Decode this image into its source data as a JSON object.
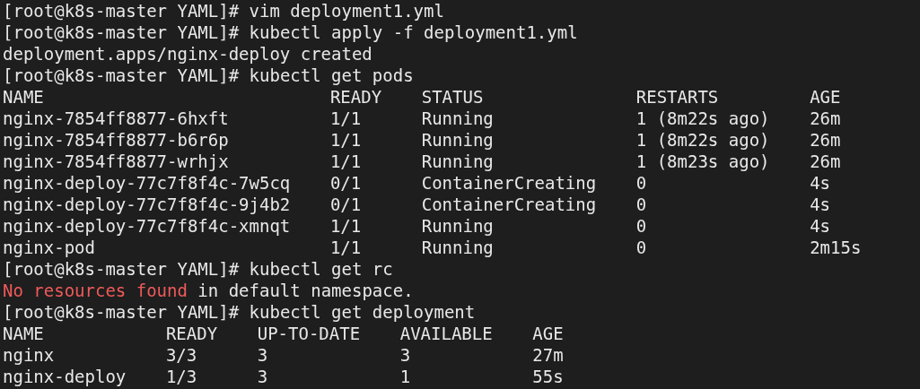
{
  "terminal": {
    "lines": [
      {
        "kind": "prompt",
        "prompt": "[root@k8s-master YAML]#",
        "command": "vim deployment1.yml"
      },
      {
        "kind": "prompt",
        "prompt": "[root@k8s-master YAML]#",
        "command": "kubectl apply -f deployment1.yml"
      },
      {
        "kind": "output",
        "text": "deployment.apps/nginx-deploy created"
      },
      {
        "kind": "prompt",
        "prompt": "[root@k8s-master YAML]#",
        "command": "kubectl get pods"
      },
      {
        "kind": "table",
        "columns": [
          "NAME",
          "READY",
          "STATUS",
          "RESTARTS",
          "AGE"
        ],
        "rows": [
          [
            "nginx-7854ff8877-6hxft",
            "1/1",
            "Running",
            "1 (8m22s ago)",
            "26m"
          ],
          [
            "nginx-7854ff8877-b6r6p",
            "1/1",
            "Running",
            "1 (8m22s ago)",
            "26m"
          ],
          [
            "nginx-7854ff8877-wrhjx",
            "1/1",
            "Running",
            "1 (8m23s ago)",
            "26m"
          ],
          [
            "nginx-deploy-77c7f8f4c-7w5cq",
            "0/1",
            "ContainerCreating",
            "0",
            "4s"
          ],
          [
            "nginx-deploy-77c7f8f4c-9j4b2",
            "0/1",
            "ContainerCreating",
            "0",
            "4s"
          ],
          [
            "nginx-deploy-77c7f8f4c-xmnqt",
            "1/1",
            "Running",
            "0",
            "4s"
          ],
          [
            "nginx-pod",
            "1/1",
            "Running",
            "0",
            "2m15s"
          ]
        ]
      },
      {
        "kind": "prompt",
        "prompt": "[root@k8s-master YAML]#",
        "command": "kubectl get rc"
      },
      {
        "kind": "error",
        "error": "No resources found",
        "text": "in default namespace."
      },
      {
        "kind": "prompt",
        "prompt": "[root@k8s-master YAML]#",
        "command": "kubectl get deployment"
      },
      {
        "kind": "table",
        "columns": [
          "NAME",
          "READY",
          "UP-TO-DATE",
          "AVAILABLE",
          "AGE"
        ],
        "rows": [
          [
            "nginx",
            "3/3",
            "3",
            "3",
            "27m"
          ],
          [
            "nginx-deploy",
            "1/3",
            "3",
            "1",
            "55s"
          ]
        ]
      }
    ]
  }
}
